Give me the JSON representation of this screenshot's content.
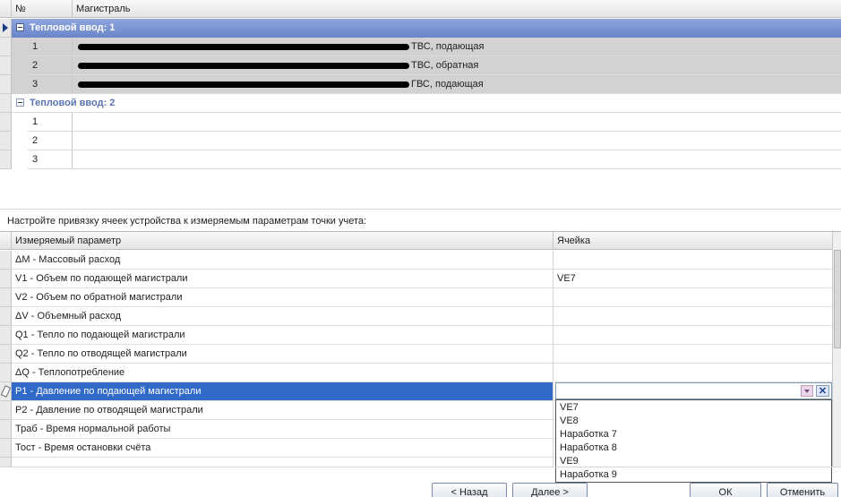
{
  "top_grid": {
    "headers": {
      "num": "№",
      "main": "Магистраль"
    },
    "groups": [
      {
        "label": "Тепловой ввод: 1",
        "rows": [
          {
            "num": "1",
            "text": "ТВС, подающая"
          },
          {
            "num": "2",
            "text": "ТВС, обратная"
          },
          {
            "num": "3",
            "text": "ГВС, подающая"
          }
        ]
      },
      {
        "label": "Тепловой ввод: 2",
        "rows": [
          {
            "num": "1",
            "text": ""
          },
          {
            "num": "2",
            "text": ""
          },
          {
            "num": "3",
            "text": ""
          }
        ]
      }
    ]
  },
  "instruction": "Настройте привязку ячеек устройства к измеряемым параметрам точки учета:",
  "param_grid": {
    "headers": {
      "param": "Измеряемый параметр",
      "cell": "Ячейка"
    },
    "rows": [
      {
        "param": "ΔM - Массовый расход",
        "cell": ""
      },
      {
        "param": "V1 - Объем по подающей магистрали",
        "cell": "VE7"
      },
      {
        "param": "V2 - Объем по обратной магистрали",
        "cell": ""
      },
      {
        "param": "ΔV - Объемный расход",
        "cell": ""
      },
      {
        "param": "Q1 - Тепло по подающей магистрали",
        "cell": ""
      },
      {
        "param": "Q2 - Тепло по отводящей магистрали",
        "cell": ""
      },
      {
        "param": "ΔQ - Теплопотребление",
        "cell": ""
      },
      {
        "param": "P1 - Давление по подающей магистрали",
        "cell": ""
      },
      {
        "param": "P2 - Давление по отводящей магистрали",
        "cell": ""
      },
      {
        "param": "Траб - Время нормальной работы",
        "cell": ""
      },
      {
        "param": "Тост - Время остановки счёта",
        "cell": ""
      },
      {
        "param": "",
        "cell": ""
      }
    ]
  },
  "dropdown": {
    "options": [
      "VE7",
      "VE8",
      "Наработка 7",
      "Наработка 8",
      "VE9",
      "Наработка 9"
    ],
    "clear_label": "✕"
  },
  "buttons": {
    "back": "< Назад",
    "next": "Далее >",
    "ok": "ОК",
    "cancel": "Отменить"
  }
}
